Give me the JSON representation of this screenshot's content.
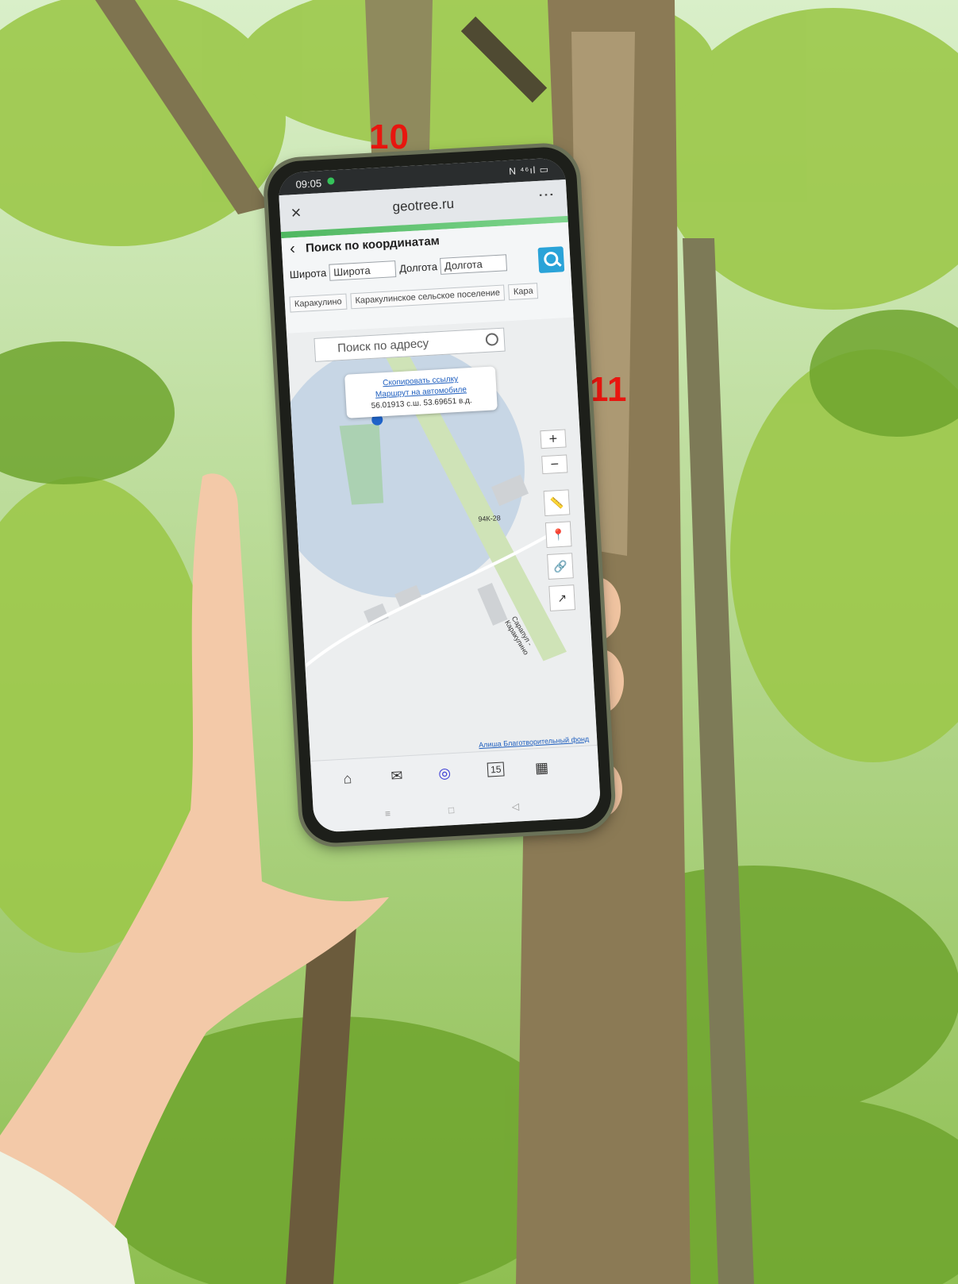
{
  "scene": {
    "tree_labels": [
      "10",
      "11"
    ],
    "colors": {
      "label": "#e8160f",
      "foliage": "#7fb33a",
      "bark": "#8b7a55",
      "sky": "#dff0d2"
    }
  },
  "phone": {
    "status": {
      "time": "09:05",
      "signal": "N ⁴⁶ıl ▭"
    },
    "browser": {
      "close_icon": "×",
      "url": "geotree.ru",
      "menu_icon": "⋮"
    },
    "panel": {
      "back_icon": "‹",
      "title": "Поиск по координатам",
      "lat_label": "Широта",
      "lat_placeholder": "Широта",
      "lon_label": "Долгота",
      "lon_placeholder": "Долгота",
      "search_icon": "search-icon",
      "chips": [
        "Каракулино",
        "Каракулинское сельское поселение",
        "Кара"
      ]
    },
    "map": {
      "address_placeholder": "Поиск по адресу",
      "popup": {
        "copy_link": "Скопировать ссылку",
        "route_link": "Маршрут на автомобиле",
        "coords": "56.01913 с.ш. 53.69651 в.д."
      },
      "zoom_in": "+",
      "zoom_out": "−",
      "road_label_1": "94К-28",
      "road_label_2": "Сарапул - Каракулино",
      "credit": "Алиша Благотворительный фонд"
    },
    "nav": {
      "home": "⌂",
      "badge": "✉",
      "alice": "◎",
      "calendar": "15",
      "apps": "▦"
    }
  }
}
